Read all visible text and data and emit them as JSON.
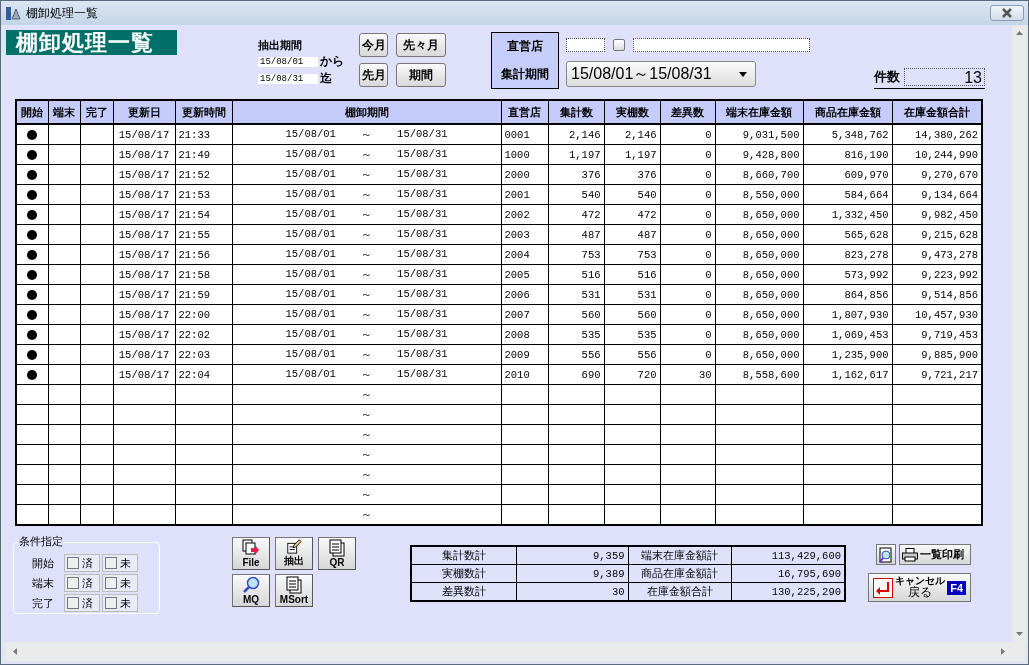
{
  "window": {
    "title": "棚卸処理一覧"
  },
  "heading": "棚卸処理一覧",
  "extraction": {
    "label": "抽出期間",
    "from": "15/08/01",
    "from_suffix": "から",
    "to": "15/08/31",
    "to_suffix": "迄"
  },
  "period_buttons": [
    "今月",
    "先々月",
    "先月",
    "期間"
  ],
  "filter_labels": [
    "直営店",
    "集計期間"
  ],
  "store_checkbox": {
    "checked": false
  },
  "period_select": {
    "value": "15/08/01～15/08/31"
  },
  "count": {
    "label": "件数",
    "value": "13"
  },
  "table": {
    "columns": [
      "開始",
      "端末",
      "完了",
      "更新日",
      "更新時間",
      "棚卸期間",
      "直営店",
      "集計数",
      "実棚数",
      "差異数",
      "端末在庫金額",
      "商品在庫金額",
      "在庫金額合計"
    ],
    "rows": [
      {
        "started": true,
        "terminal": false,
        "completed": false,
        "date": "15/08/17",
        "time": "21:33",
        "period_from": "15/08/01",
        "period_sep": "～",
        "period_to": "15/08/31",
        "store": "0001",
        "counted": "2,146",
        "actual": "2,146",
        "diff": "0",
        "terminal_amount": "9,031,500",
        "product_amount": "5,348,762",
        "total_amount": "14,380,262"
      },
      {
        "started": true,
        "terminal": false,
        "completed": false,
        "date": "15/08/17",
        "time": "21:49",
        "period_from": "15/08/01",
        "period_sep": "～",
        "period_to": "15/08/31",
        "store": "1000",
        "counted": "1,197",
        "actual": "1,197",
        "diff": "0",
        "terminal_amount": "9,428,800",
        "product_amount": "816,190",
        "total_amount": "10,244,990"
      },
      {
        "started": true,
        "terminal": false,
        "completed": false,
        "date": "15/08/17",
        "time": "21:52",
        "period_from": "15/08/01",
        "period_sep": "～",
        "period_to": "15/08/31",
        "store": "2000",
        "counted": "376",
        "actual": "376",
        "diff": "0",
        "terminal_amount": "8,660,700",
        "product_amount": "609,970",
        "total_amount": "9,270,670"
      },
      {
        "started": true,
        "terminal": false,
        "completed": false,
        "date": "15/08/17",
        "time": "21:53",
        "period_from": "15/08/01",
        "period_sep": "～",
        "period_to": "15/08/31",
        "store": "2001",
        "counted": "540",
        "actual": "540",
        "diff": "0",
        "terminal_amount": "8,550,000",
        "product_amount": "584,664",
        "total_amount": "9,134,664"
      },
      {
        "started": true,
        "terminal": false,
        "completed": false,
        "date": "15/08/17",
        "time": "21:54",
        "period_from": "15/08/01",
        "period_sep": "～",
        "period_to": "15/08/31",
        "store": "2002",
        "counted": "472",
        "actual": "472",
        "diff": "0",
        "terminal_amount": "8,650,000",
        "product_amount": "1,332,450",
        "total_amount": "9,982,450"
      },
      {
        "started": true,
        "terminal": false,
        "completed": false,
        "date": "15/08/17",
        "time": "21:55",
        "period_from": "15/08/01",
        "period_sep": "～",
        "period_to": "15/08/31",
        "store": "2003",
        "counted": "487",
        "actual": "487",
        "diff": "0",
        "terminal_amount": "8,650,000",
        "product_amount": "565,628",
        "total_amount": "9,215,628"
      },
      {
        "started": true,
        "terminal": false,
        "completed": false,
        "date": "15/08/17",
        "time": "21:56",
        "period_from": "15/08/01",
        "period_sep": "～",
        "period_to": "15/08/31",
        "store": "2004",
        "counted": "753",
        "actual": "753",
        "diff": "0",
        "terminal_amount": "8,650,000",
        "product_amount": "823,278",
        "total_amount": "9,473,278"
      },
      {
        "started": true,
        "terminal": false,
        "completed": false,
        "date": "15/08/17",
        "time": "21:58",
        "period_from": "15/08/01",
        "period_sep": "～",
        "period_to": "15/08/31",
        "store": "2005",
        "counted": "516",
        "actual": "516",
        "diff": "0",
        "terminal_amount": "8,650,000",
        "product_amount": "573,992",
        "total_amount": "9,223,992"
      },
      {
        "started": true,
        "terminal": false,
        "completed": false,
        "date": "15/08/17",
        "time": "21:59",
        "period_from": "15/08/01",
        "period_sep": "～",
        "period_to": "15/08/31",
        "store": "2006",
        "counted": "531",
        "actual": "531",
        "diff": "0",
        "terminal_amount": "8,650,000",
        "product_amount": "864,856",
        "total_amount": "9,514,856"
      },
      {
        "started": true,
        "terminal": false,
        "completed": false,
        "date": "15/08/17",
        "time": "22:00",
        "period_from": "15/08/01",
        "period_sep": "～",
        "period_to": "15/08/31",
        "store": "2007",
        "counted": "560",
        "actual": "560",
        "diff": "0",
        "terminal_amount": "8,650,000",
        "product_amount": "1,807,930",
        "total_amount": "10,457,930"
      },
      {
        "started": true,
        "terminal": false,
        "completed": false,
        "date": "15/08/17",
        "time": "22:02",
        "period_from": "15/08/01",
        "period_sep": "～",
        "period_to": "15/08/31",
        "store": "2008",
        "counted": "535",
        "actual": "535",
        "diff": "0",
        "terminal_amount": "8,650,000",
        "product_amount": "1,069,453",
        "total_amount": "9,719,453"
      },
      {
        "started": true,
        "terminal": false,
        "completed": false,
        "date": "15/08/17",
        "time": "22:03",
        "period_from": "15/08/01",
        "period_sep": "～",
        "period_to": "15/08/31",
        "store": "2009",
        "counted": "556",
        "actual": "556",
        "diff": "0",
        "terminal_amount": "8,650,000",
        "product_amount": "1,235,900",
        "total_amount": "9,885,900"
      },
      {
        "started": true,
        "terminal": false,
        "completed": false,
        "date": "15/08/17",
        "time": "22:04",
        "period_from": "15/08/01",
        "period_sep": "～",
        "period_to": "15/08/31",
        "store": "2010",
        "counted": "690",
        "actual": "720",
        "diff": "30",
        "terminal_amount": "8,558,600",
        "product_amount": "1,162,617",
        "total_amount": "9,721,217"
      },
      {
        "started": false,
        "terminal": false,
        "completed": false,
        "period_sep": "～"
      },
      {
        "started": false,
        "terminal": false,
        "completed": false,
        "period_sep": "～"
      },
      {
        "started": false,
        "terminal": false,
        "completed": false,
        "period_sep": "～"
      },
      {
        "started": false,
        "terminal": false,
        "completed": false,
        "period_sep": "～"
      },
      {
        "started": false,
        "terminal": false,
        "completed": false,
        "period_sep": "～"
      },
      {
        "started": false,
        "terminal": false,
        "completed": false,
        "period_sep": "～"
      },
      {
        "started": false,
        "terminal": false,
        "completed": false,
        "period_sep": "～"
      }
    ]
  },
  "conditions": {
    "title": "条件指定",
    "rows": [
      {
        "label": "開始",
        "options": [
          {
            "label": "済",
            "checked": false
          },
          {
            "label": "未",
            "checked": false
          }
        ]
      },
      {
        "label": "端末",
        "options": [
          {
            "label": "済",
            "checked": false
          },
          {
            "label": "未",
            "checked": false
          }
        ]
      },
      {
        "label": "完了",
        "options": [
          {
            "label": "済",
            "checked": false
          },
          {
            "label": "未",
            "checked": false
          }
        ]
      }
    ]
  },
  "tool_buttons": [
    {
      "label": "File",
      "kind": "file"
    },
    {
      "label": "抽出",
      "kind": "extract"
    },
    {
      "label": "QR",
      "kind": "docs"
    },
    {
      "label": "MQ",
      "kind": "search"
    },
    {
      "label": "MSort",
      "kind": "docs"
    }
  ],
  "totals": [
    [
      {
        "label": "集計数計",
        "value": "9,359"
      },
      {
        "label": "端末在庫金額計",
        "value": "113,429,600"
      }
    ],
    [
      {
        "label": "実棚数計",
        "value": "9,389"
      },
      {
        "label": "商品在庫金額計",
        "value": "16,795,690"
      }
    ],
    [
      {
        "label": "差異数計",
        "value": "30"
      },
      {
        "label": "在庫金額合計",
        "value": "130,225,290"
      }
    ]
  ],
  "print_button": {
    "label": "一覧印刷"
  },
  "cancel_button": {
    "line1": "キャンセル",
    "line2": "戻る",
    "key": "F4"
  }
}
